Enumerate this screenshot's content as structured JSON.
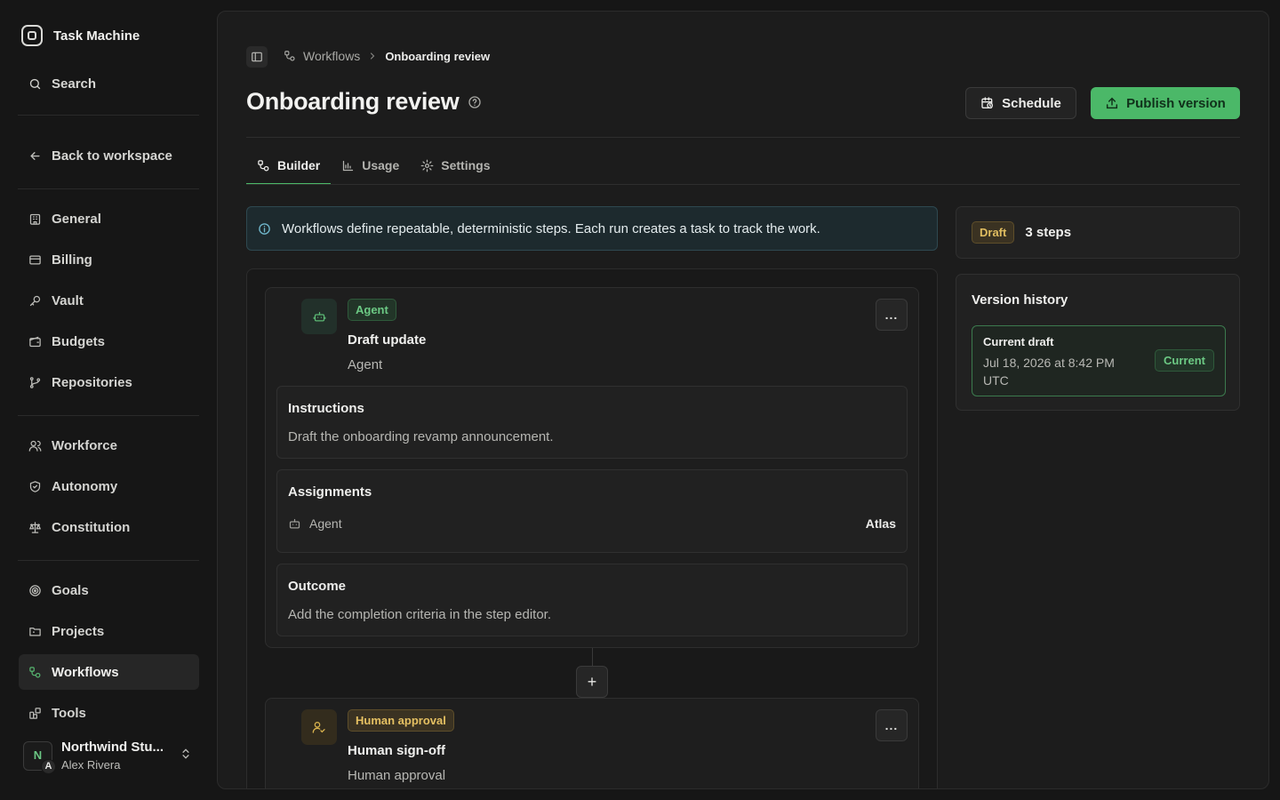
{
  "app": {
    "name": "Task Machine"
  },
  "sidebar": {
    "search_label": "Search",
    "back_label": "Back to workspace",
    "items": [
      {
        "label": "General",
        "icon": "building-icon"
      },
      {
        "label": "Billing",
        "icon": "credit-card-icon"
      },
      {
        "label": "Vault",
        "icon": "key-icon"
      },
      {
        "label": "Budgets",
        "icon": "wallet-icon"
      },
      {
        "label": "Repositories",
        "icon": "git-branch-icon"
      },
      {
        "label": "Workforce",
        "icon": "users-icon"
      },
      {
        "label": "Autonomy",
        "icon": "shield-icon"
      },
      {
        "label": "Constitution",
        "icon": "scale-icon"
      },
      {
        "label": "Goals",
        "icon": "target-icon"
      },
      {
        "label": "Projects",
        "icon": "folder-icon"
      },
      {
        "label": "Workflows",
        "icon": "workflow-icon",
        "active": true
      },
      {
        "label": "Tools",
        "icon": "tools-icon"
      }
    ],
    "org": {
      "avatar_letter": "N",
      "user_initial": "A",
      "name": "Northwind Stu...",
      "user": "Alex Rivera"
    }
  },
  "breadcrumb": {
    "parent": "Workflows",
    "current": "Onboarding review"
  },
  "page": {
    "title": "Onboarding review",
    "schedule_label": "Schedule",
    "publish_label": "Publish version"
  },
  "tabs": [
    {
      "label": "Builder",
      "active": true
    },
    {
      "label": "Usage"
    },
    {
      "label": "Settings"
    }
  ],
  "info_banner": "Workflows define repeatable, deterministic steps. Each run creates a task to track the work.",
  "steps": [
    {
      "badge": "Agent",
      "title": "Draft update",
      "subtitle": "Agent",
      "instructions_heading": "Instructions",
      "instructions_text": "Draft the onboarding revamp announcement.",
      "assignments_heading": "Assignments",
      "assignment_role": "Agent",
      "assignment_value": "Atlas",
      "outcome_heading": "Outcome",
      "outcome_text": "Add the completion criteria in the step editor."
    },
    {
      "badge": "Human approval",
      "title": "Human sign-off",
      "subtitle": "Human approval"
    }
  ],
  "more_label": "...",
  "add_label": "+",
  "summary": {
    "status": "Draft",
    "steps": "3 steps"
  },
  "version_history": {
    "heading": "Version history",
    "current": {
      "title": "Current draft",
      "date": "Jul 18, 2026 at 8:42 PM UTC",
      "badge": "Current"
    }
  },
  "colors": {
    "accent": "#4bb868",
    "background": "#161616",
    "panel": "#1c1c1c",
    "warning": "#e0bd60"
  }
}
